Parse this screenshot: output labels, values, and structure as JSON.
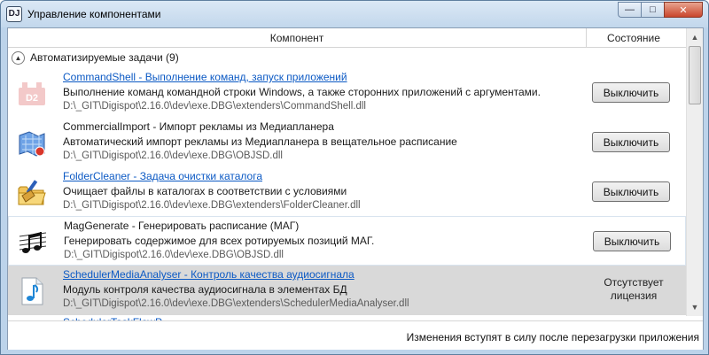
{
  "window": {
    "title": "Управление компонентами"
  },
  "table": {
    "headers": {
      "component": "Компонент",
      "state": "Состояние"
    },
    "group": {
      "label": "Автоматизируемые задачи (9)"
    },
    "items": [
      {
        "name": "CommandShell - Выполнение команд, запуск приложений",
        "description": "Выполнение команд командной строки Windows, а также сторонних приложений с аргументами.",
        "path": "D:\\_GIT\\Digispot\\2.16.0\\dev\\exe.DBG\\extenders\\CommandShell.dll",
        "button": "Выключить",
        "is_link": true,
        "icon": "d2-plugin-icon"
      },
      {
        "name": "CommercialImport - Импорт рекламы из Медиапланера",
        "description": "Автоматический импорт рекламы из Медиапланера в вещательное расписание",
        "path": "D:\\_GIT\\Digispot\\2.16.0\\dev\\exe.DBG\\OBJSD.dll",
        "button": "Выключить",
        "is_link": false,
        "icon": "map-import-icon"
      },
      {
        "name": "FolderCleaner - Задача очистки каталога",
        "description": "Очищает файлы в каталогах в соответствии с условиями",
        "path": "D:\\_GIT\\Digispot\\2.16.0\\dev\\exe.DBG\\extenders\\FolderCleaner.dll",
        "button": "Выключить",
        "is_link": true,
        "icon": "folder-broom-icon"
      },
      {
        "name": "MagGenerate - Генерировать расписание (МАГ)",
        "description": "Генерировать содержимое для всех ротируемых позиций МАГ.",
        "path": "D:\\_GIT\\Digispot\\2.16.0\\dev\\exe.DBG\\OBJSD.dll",
        "button": "Выключить",
        "is_link": false,
        "icon": "music-notes-icon"
      },
      {
        "name": "SchedulerMediaAnalyser - Контроль качества аудиосигнала",
        "description": "Модуль контроля качества аудиосигнала в элементах БД",
        "path": "D:\\_GIT\\Digispot\\2.16.0\\dev\\exe.DBG\\extenders\\SchedulerMediaAnalyser.dll",
        "status_line1": "Отсутствует",
        "status_line2": "лицензия",
        "is_link": true,
        "icon": "audio-note-icon"
      }
    ],
    "next_item_fragment": "SchedulerTaskFlowP..."
  },
  "footer": {
    "text": "Изменения вступят в силу после перезагрузки приложения"
  },
  "colors": {
    "link": "#0b59c4",
    "selected_row": "#d9d9d9",
    "title_bg": "#c2d7ec"
  }
}
